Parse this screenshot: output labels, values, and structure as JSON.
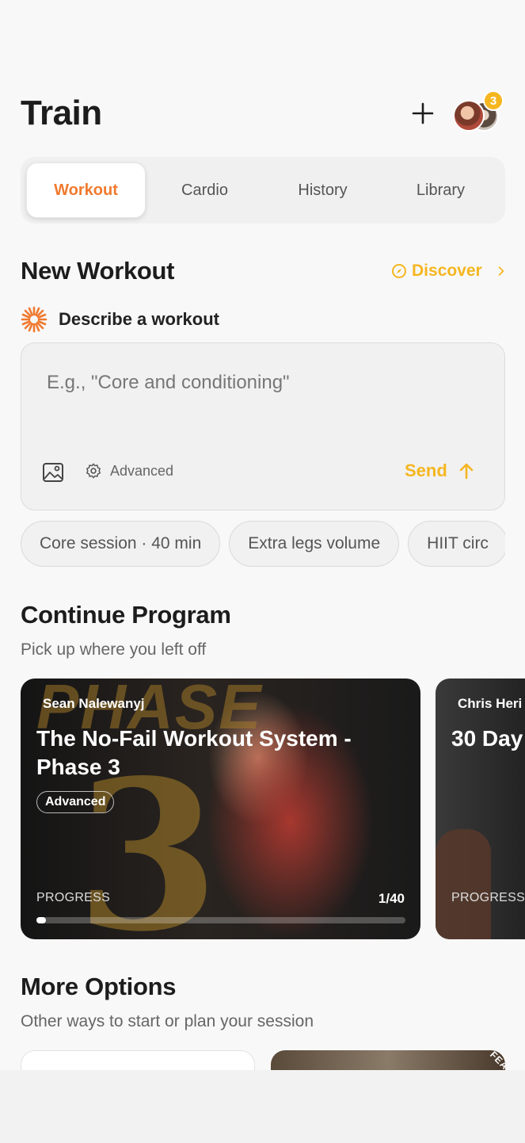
{
  "header": {
    "title": "Train",
    "avatar_badge": "3"
  },
  "tabs": [
    {
      "label": "Workout",
      "active": true
    },
    {
      "label": "Cardio",
      "active": false
    },
    {
      "label": "History",
      "active": false
    },
    {
      "label": "Library",
      "active": false
    }
  ],
  "new_workout": {
    "title": "New Workout",
    "discover_label": "Discover",
    "describe_label": "Describe a workout",
    "input_placeholder": "E.g., \"Core and conditioning\"",
    "advanced_label": "Advanced",
    "send_label": "Send",
    "suggestions": [
      "Core session · 40 min",
      "Extra legs volume",
      "HIIT circ"
    ]
  },
  "continue_program": {
    "title": "Continue Program",
    "subtitle": "Pick up where you left off",
    "cards": [
      {
        "author": "Sean Nalewanyj",
        "title": "The No-Fail Workout System - Phase 3",
        "level": "Advanced",
        "progress_label": "PROGRESS",
        "progress_text": "1/40",
        "progress_fraction": 0.025,
        "background_text_top": "PHASE",
        "background_text_number": "3"
      },
      {
        "author": "Chris Heri",
        "title": "30 Day",
        "progress_label": "PROGRESS"
      }
    ]
  },
  "more_options": {
    "title": "More Options",
    "subtitle": "Other ways to start or plan your session",
    "feature_tag": "FEA"
  },
  "colors": {
    "accent_orange": "#f07a2e",
    "accent_yellow": "#f5b620"
  }
}
